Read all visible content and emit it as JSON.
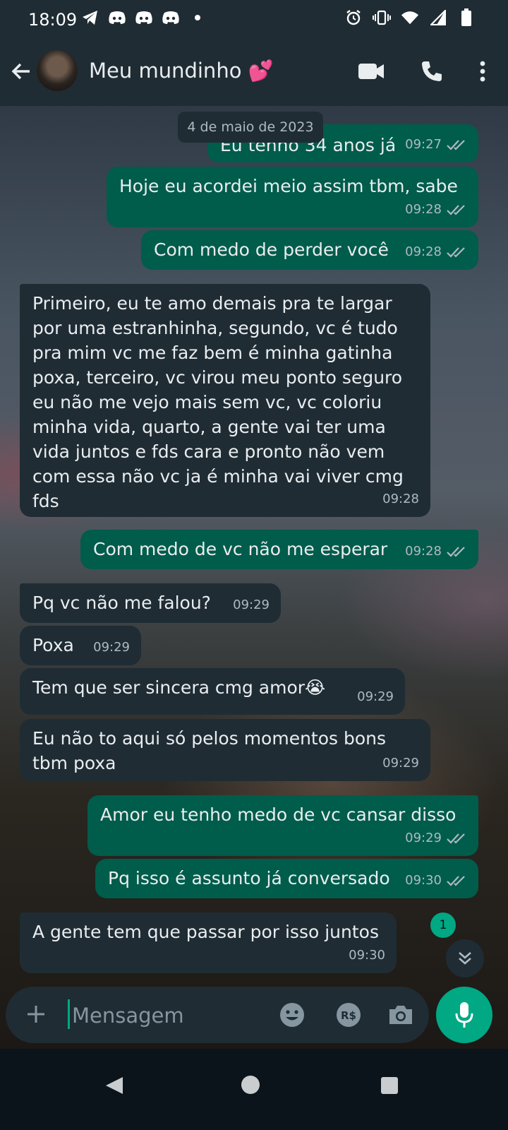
{
  "status_bar": {
    "time": "18:09",
    "left_icons": [
      "telegram-icon",
      "discord-icon",
      "discord-icon",
      "discord-icon",
      "dot-icon"
    ],
    "right_icons": [
      "alarm-icon",
      "vibrate-icon",
      "wifi-icon",
      "signal-icon",
      "battery-icon"
    ]
  },
  "header": {
    "title": "Meu mundinho 💕",
    "actions": [
      "video-call-icon",
      "voice-call-icon",
      "more-options-icon"
    ]
  },
  "date_chip": "4 de maio de 2023",
  "messages": [
    {
      "direction": "out",
      "text": "Eu tenho 34 anos já",
      "time": "09:27",
      "status": "read"
    },
    {
      "direction": "out",
      "text": "Hoje eu acordei meio assim tbm, sabe",
      "time": "09:28",
      "status": "read"
    },
    {
      "direction": "out",
      "text": "Com medo de perder você",
      "time": "09:28",
      "status": "read"
    },
    {
      "direction": "in",
      "text": "Primeiro, eu te amo demais pra te largar por uma estranhinha, segundo, vc é tudo pra mim vc me faz bem é minha gatinha poxa, terceiro, vc virou meu ponto seguro eu não me vejo mais sem vc, vc coloriu minha vida, quarto, a gente vai ter uma vida juntos e fds cara e pronto não vem com essa não vc ja é minha vai viver cmg fds",
      "time": "09:28"
    },
    {
      "direction": "out",
      "text": "Com medo de vc não me esperar",
      "time": "09:28",
      "status": "read"
    },
    {
      "direction": "in",
      "text": "Pq vc não me falou?",
      "time": "09:29"
    },
    {
      "direction": "in",
      "text": "Poxa",
      "time": "09:29"
    },
    {
      "direction": "in",
      "text": "Tem que ser sincera cmg amor😭",
      "time": "09:29"
    },
    {
      "direction": "in",
      "text": "Eu não to aqui só pelos momentos bons tbm poxa",
      "time": "09:29"
    },
    {
      "direction": "out",
      "text": "Amor eu tenho medo de vc cansar disso",
      "time": "09:29",
      "status": "read"
    },
    {
      "direction": "out",
      "text": "Pq isso é assunto já conversado",
      "time": "09:30",
      "status": "read"
    },
    {
      "direction": "in",
      "text": "A gente tem que passar por isso juntos",
      "time": "09:30"
    }
  ],
  "unread_count": "1",
  "composer": {
    "placeholder": "Mensagem",
    "icons": [
      "emoji-icon",
      "payment-icon",
      "camera-icon"
    ],
    "mic": "microphone-icon"
  },
  "colors": {
    "outgoing_bubble": "#005c4b",
    "incoming_bubble": "#1f2c34",
    "accent": "#00a884",
    "read_ticks": "#aebac1"
  }
}
